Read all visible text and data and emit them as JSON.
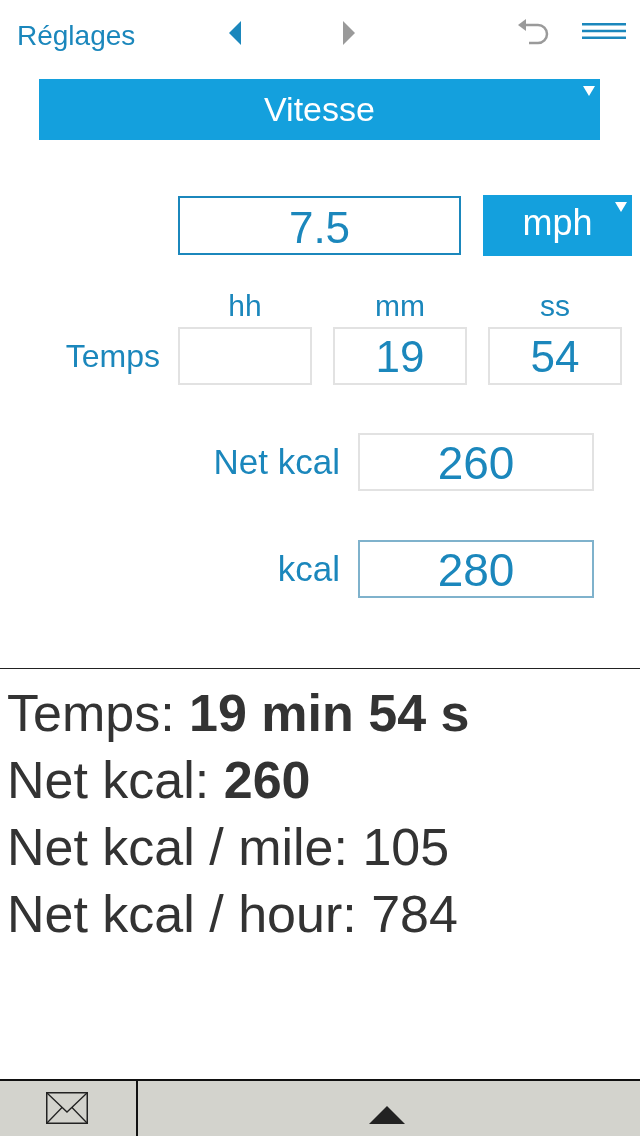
{
  "toolbar": {
    "settings_link": "Réglages",
    "nav_buttons": [
      {
        "kind": "previous",
        "disabled": false
      },
      {
        "kind": "next",
        "disabled": true
      }
    ],
    "undo": {
      "disabled": true
    }
  },
  "mode_dropdown": {
    "value": "Vitesse"
  },
  "speed": {
    "value": "7.5",
    "unit": "mph",
    "focused": true
  },
  "time": {
    "label": "Temps",
    "fields": [
      {
        "heading": "hh"
      },
      {
        "heading": "mm",
        "value": "19"
      },
      {
        "heading": "ss",
        "value": "54"
      }
    ]
  },
  "calories": [
    {
      "label": "Net kcal",
      "value": "260",
      "highlighted": false
    },
    {
      "label": "kcal",
      "value": "280",
      "highlighted": true
    }
  ],
  "summary": [
    "Temps: **19 min 54 s**",
    "Net kcal: **260**",
    "Net kcal / mile: 105",
    "Net kcal / hour: 784"
  ]
}
